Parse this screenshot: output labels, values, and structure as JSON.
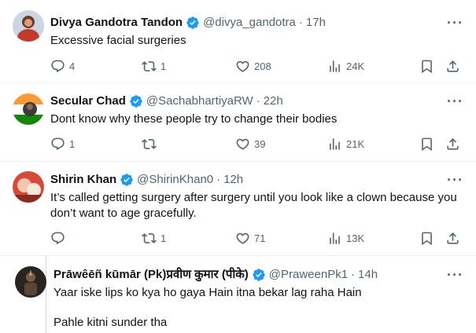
{
  "tweets": [
    {
      "name": "Divya Gandotra Tandon",
      "handle": "@divya_gandotra",
      "time": "17h",
      "text": "Excessive facial surgeries",
      "replies": "4",
      "retweets": "1",
      "likes": "208",
      "views": "24K"
    },
    {
      "name": "Secular Chad",
      "handle": "@SachabhartiyaRW",
      "time": "22h",
      "text": "Dont know why these people try to change their bodies",
      "replies": "1",
      "retweets": "",
      "likes": "39",
      "views": "21K"
    },
    {
      "name": "Shirin Khan",
      "handle": "@ShirinKhan0",
      "time": "12h",
      "text": "It’s called getting surgery after surgery until you look like a clown because you don’t want to age gracefully.",
      "replies": "",
      "retweets": "1",
      "likes": "71",
      "views": "13K"
    },
    {
      "name": "Prāwêēñ kūmār (Pk)प्रवीण कुमार (पीके)",
      "handle": "@PraweenPk1",
      "time": "14h",
      "text": "Yaar iske lips ko kya ho gaya Hain itna bekar lag raha Hain",
      "text2": "Pahle kitni sunder tha"
    }
  ],
  "separator": "·",
  "more_label": "···",
  "colors": {
    "verified": "#1d9bf0",
    "muted": "#536471",
    "border": "#eff3f4"
  },
  "icons": [
    "reply-icon",
    "retweet-icon",
    "like-icon",
    "views-icon",
    "bookmark-icon",
    "share-icon",
    "verified-badge-icon",
    "more-icon"
  ]
}
